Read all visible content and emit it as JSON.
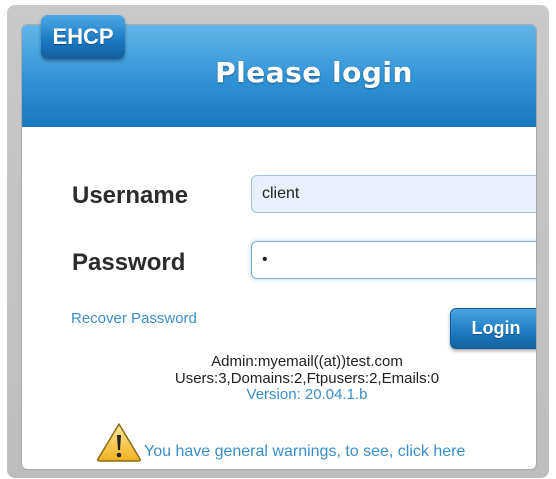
{
  "header": {
    "brand": "EHCP",
    "title": "Please login"
  },
  "form": {
    "username_label": "Username",
    "username_value": "client",
    "password_label": "Password",
    "password_value": "x"
  },
  "links": {
    "recover_password": "Recover Password"
  },
  "buttons": {
    "login": "Login"
  },
  "info": {
    "admin": "Admin:myemail((at))test.com",
    "stats": "Users:3,Domains:2,Ftpusers:2,Emails:0",
    "version": "Version: 20.04.1.b"
  },
  "warning": {
    "text": "You have general warnings, to see, click here",
    "icon": "warning-icon"
  },
  "colors": {
    "header_blue": "#2f93d6",
    "link_blue": "#3a8ec9",
    "frame_gray": "#c4c4c4"
  }
}
